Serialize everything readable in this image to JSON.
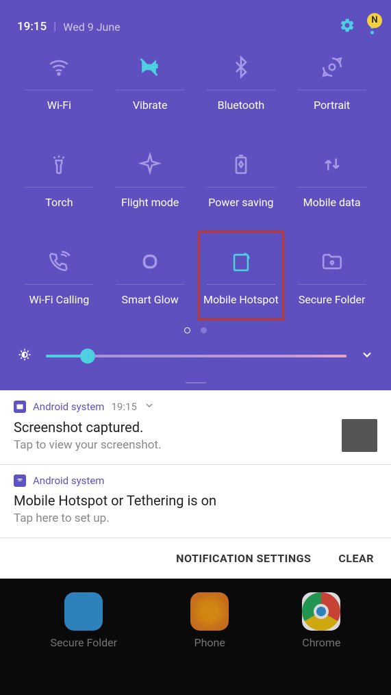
{
  "status": {
    "time": "19:15",
    "date": "Wed 9 June",
    "badge": "N"
  },
  "tiles": [
    {
      "label": "Wi-Fi",
      "icon": "wifi",
      "active": false
    },
    {
      "label": "Vibrate",
      "icon": "vibrate",
      "active": true
    },
    {
      "label": "Bluetooth",
      "icon": "bluetooth",
      "active": false
    },
    {
      "label": "Portrait",
      "icon": "rotation",
      "active": false
    },
    {
      "label": "Torch",
      "icon": "torch",
      "active": false
    },
    {
      "label": "Flight mode",
      "icon": "airplane",
      "active": false
    },
    {
      "label": "Power saving",
      "icon": "battery",
      "active": false
    },
    {
      "label": "Mobile data",
      "icon": "data",
      "active": false
    },
    {
      "label": "Wi-Fi Calling",
      "icon": "wificall",
      "active": false
    },
    {
      "label": "Smart Glow",
      "icon": "glow",
      "active": false
    },
    {
      "label": "Mobile Hotspot",
      "icon": "hotspot",
      "active": true,
      "highlighted": true
    },
    {
      "label": "Secure Folder",
      "icon": "folder",
      "active": false
    }
  ],
  "brightness": {
    "percent": 14
  },
  "notifications": [
    {
      "app": "Android system",
      "time": "19:15",
      "title": "Screenshot captured.",
      "subtitle": "Tap to view your screenshot.",
      "showChevron": true,
      "showThumb": true
    },
    {
      "app": "Android system",
      "title": "Mobile Hotspot or Tethering is on",
      "subtitle": "Tap here to set up.",
      "showChevron": false,
      "showThumb": false
    }
  ],
  "actions": {
    "settings": "NOTIFICATION SETTINGS",
    "clear": "CLEAR"
  },
  "homeApps": [
    {
      "label": "Secure Folder",
      "type": "blue"
    },
    {
      "label": "Phone",
      "type": "orange"
    },
    {
      "label": "Chrome",
      "type": "chrome"
    }
  ]
}
